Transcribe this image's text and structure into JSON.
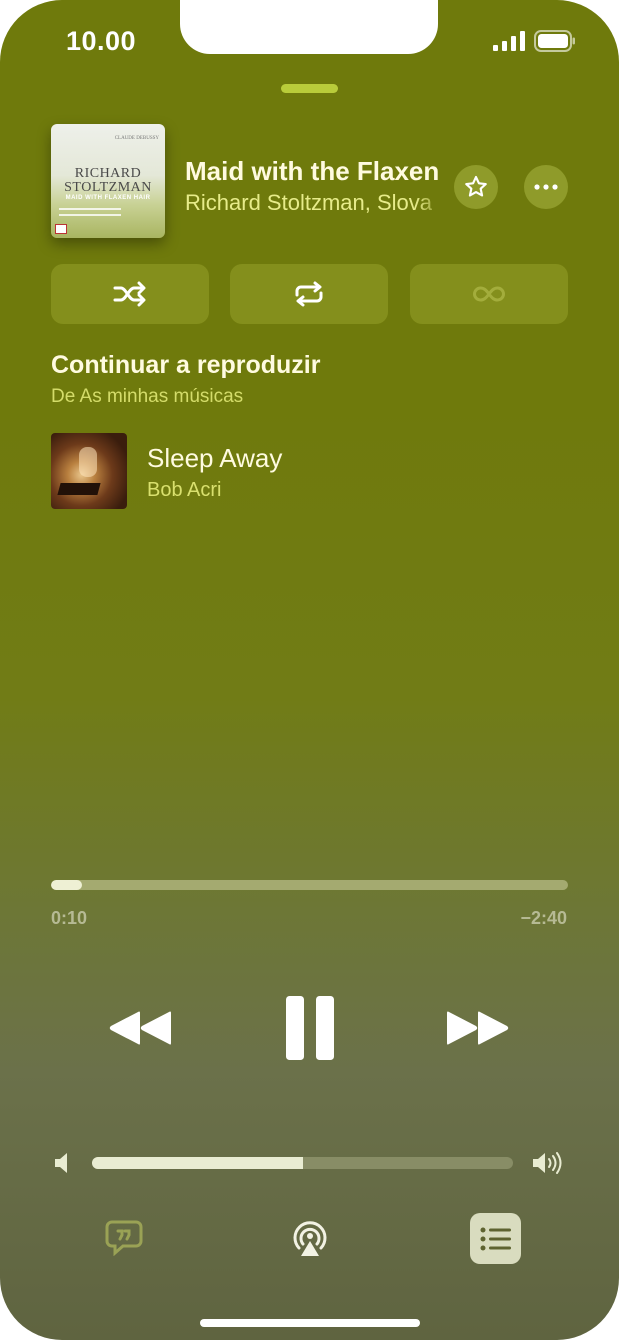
{
  "status_bar": {
    "time": "10.00"
  },
  "now_playing": {
    "artwork": {
      "composer": "CLAUDE DEBUSSY",
      "artist_text": "RICHARD STOLTZMAN",
      "album_text": "MAID WITH FLAXEN HAIR"
    },
    "title": "Maid with the Flaxen",
    "artist": "Richard Stoltzman, Slova"
  },
  "modes": {
    "shuffle_icon": "shuffle-icon",
    "repeat_icon": "repeat-icon",
    "autoplay_icon": "infinity-icon"
  },
  "queue": {
    "section_title": "Continuar a reproduzir",
    "section_subtitle": "De As minhas músicas",
    "items": [
      {
        "title": "Sleep Away",
        "artist": "Bob Acri"
      }
    ]
  },
  "playback": {
    "elapsed": "0:10",
    "remaining": "−2:40",
    "progress": 0.06
  },
  "volume": {
    "level": 0.5
  },
  "colors": {
    "background": "#6f7a0c",
    "accent": "#e7ec8a",
    "title_text": "#fffbe0"
  }
}
